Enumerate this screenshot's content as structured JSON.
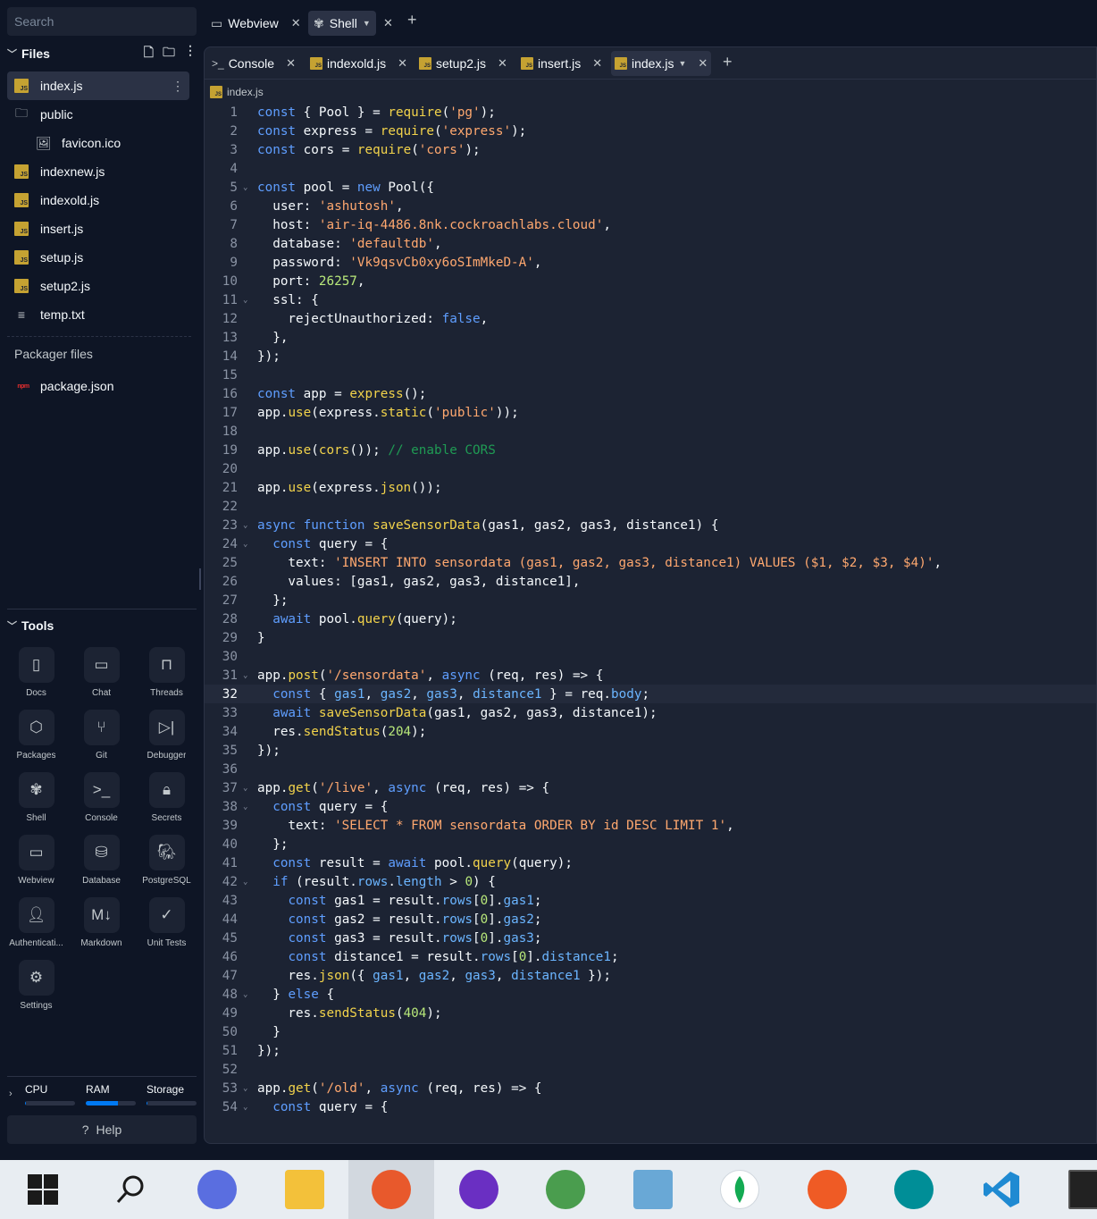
{
  "sidebar": {
    "search_placeholder": "Search",
    "files_title": "Files",
    "tree": [
      {
        "label": "index.js",
        "type": "js",
        "active": true
      },
      {
        "label": "public",
        "type": "folder"
      },
      {
        "label": "favicon.ico",
        "type": "image",
        "child": true
      },
      {
        "label": "indexnew.js",
        "type": "js"
      },
      {
        "label": "indexold.js",
        "type": "js"
      },
      {
        "label": "insert.js",
        "type": "js"
      },
      {
        "label": "setup.js",
        "type": "js"
      },
      {
        "label": "setup2.js",
        "type": "js"
      },
      {
        "label": "temp.txt",
        "type": "text"
      }
    ],
    "packager_title": "Packager files",
    "packager_item": "package.json",
    "tools_title": "Tools",
    "tools": [
      {
        "label": "Docs",
        "icon": "book-icon",
        "glyph": "▯"
      },
      {
        "label": "Chat",
        "icon": "chat-icon",
        "glyph": "▭"
      },
      {
        "label": "Threads",
        "icon": "inbox-icon",
        "glyph": "⊓"
      },
      {
        "label": "Packages",
        "icon": "package-icon",
        "glyph": "⬡"
      },
      {
        "label": "Git",
        "icon": "git-icon",
        "glyph": "⑂"
      },
      {
        "label": "Debugger",
        "icon": "debugger-icon",
        "glyph": "▷|"
      },
      {
        "label": "Shell",
        "icon": "shell-icon",
        "glyph": "✾"
      },
      {
        "label": "Console",
        "icon": "console-icon",
        "glyph": ">_"
      },
      {
        "label": "Secrets",
        "icon": "lock-icon",
        "glyph": "🔒︎"
      },
      {
        "label": "Webview",
        "icon": "monitor-icon",
        "glyph": "▭"
      },
      {
        "label": "Database",
        "icon": "database-icon",
        "glyph": "⛁"
      },
      {
        "label": "PostgreSQL",
        "icon": "postgresql-icon",
        "glyph": "🐘︎"
      },
      {
        "label": "Authenticati...",
        "icon": "user-icon",
        "glyph": "👤︎"
      },
      {
        "label": "Markdown",
        "icon": "markdown-icon",
        "glyph": "M↓"
      },
      {
        "label": "Unit Tests",
        "icon": "check-icon",
        "glyph": "✓"
      },
      {
        "label": "Settings",
        "icon": "gear-icon",
        "glyph": "⚙"
      }
    ],
    "resources": [
      {
        "label": "CPU",
        "fill": 0.02
      },
      {
        "label": "RAM",
        "fill": 0.65
      },
      {
        "label": "Storage",
        "fill": 0.02
      }
    ],
    "help": "Help"
  },
  "top_tabs": [
    {
      "label": "Webview",
      "icon": "monitor-icon"
    },
    {
      "label": "Shell",
      "icon": "shell-icon",
      "active": true
    }
  ],
  "editor_tabs": [
    {
      "label": "Console",
      "type": "console"
    },
    {
      "label": "indexold.js",
      "type": "js"
    },
    {
      "label": "setup2.js",
      "type": "js"
    },
    {
      "label": "insert.js",
      "type": "js"
    },
    {
      "label": "index.js",
      "type": "js",
      "active": true
    }
  ],
  "breadcrumb": "index.js",
  "current_line": 32,
  "code": [
    [
      [
        "kw",
        "const"
      ],
      [
        "p",
        " { Pool } = "
      ],
      [
        "fn",
        "require"
      ],
      [
        "p",
        "("
      ],
      [
        "str",
        "'pg'"
      ],
      [
        "p",
        ");"
      ]
    ],
    [
      [
        "kw",
        "const"
      ],
      [
        "p",
        " express = "
      ],
      [
        "fn",
        "require"
      ],
      [
        "p",
        "("
      ],
      [
        "str",
        "'express'"
      ],
      [
        "p",
        ");"
      ]
    ],
    [
      [
        "kw",
        "const"
      ],
      [
        "p",
        " cors = "
      ],
      [
        "fn",
        "require"
      ],
      [
        "p",
        "("
      ],
      [
        "str",
        "'cors'"
      ],
      [
        "p",
        ");"
      ]
    ],
    [],
    [
      [
        "kw",
        "const"
      ],
      [
        "p",
        " pool = "
      ],
      [
        "kw",
        "new"
      ],
      [
        "p",
        " Pool({"
      ]
    ],
    [
      [
        "p",
        "  user: "
      ],
      [
        "str",
        "'ashutosh'"
      ],
      [
        "p",
        ","
      ]
    ],
    [
      [
        "p",
        "  host: "
      ],
      [
        "str",
        "'air-iq-4486.8nk.cockroachlabs.cloud'"
      ],
      [
        "p",
        ","
      ]
    ],
    [
      [
        "p",
        "  database: "
      ],
      [
        "str",
        "'defaultdb'"
      ],
      [
        "p",
        ","
      ]
    ],
    [
      [
        "p",
        "  password: "
      ],
      [
        "str",
        "'Vk9qsvCb0xy6oSImMkeD-A'"
      ],
      [
        "p",
        ","
      ]
    ],
    [
      [
        "p",
        "  port: "
      ],
      [
        "num",
        "26257"
      ],
      [
        "p",
        ","
      ]
    ],
    [
      [
        "p",
        "  ssl: {"
      ]
    ],
    [
      [
        "p",
        "    rejectUnauthorized: "
      ],
      [
        "kw",
        "false"
      ],
      [
        "p",
        ","
      ]
    ],
    [
      [
        "p",
        "  },"
      ]
    ],
    [
      [
        "p",
        "});"
      ]
    ],
    [],
    [
      [
        "kw",
        "const"
      ],
      [
        "p",
        " app = "
      ],
      [
        "fn",
        "express"
      ],
      [
        "p",
        "();"
      ]
    ],
    [
      [
        "p",
        "app."
      ],
      [
        "fn",
        "use"
      ],
      [
        "p",
        "(express."
      ],
      [
        "fn",
        "static"
      ],
      [
        "p",
        "("
      ],
      [
        "str",
        "'public'"
      ],
      [
        "p",
        "));"
      ]
    ],
    [],
    [
      [
        "p",
        "app."
      ],
      [
        "fn",
        "use"
      ],
      [
        "p",
        "("
      ],
      [
        "fn",
        "cors"
      ],
      [
        "p",
        "()); "
      ],
      [
        "cm",
        "// enable CORS"
      ]
    ],
    [],
    [
      [
        "p",
        "app."
      ],
      [
        "fn",
        "use"
      ],
      [
        "p",
        "(express."
      ],
      [
        "fn",
        "json"
      ],
      [
        "p",
        "());"
      ]
    ],
    [],
    [
      [
        "kw",
        "async function"
      ],
      [
        "p",
        " "
      ],
      [
        "fn",
        "saveSensorData"
      ],
      [
        "p",
        "(gas1, gas2, gas3, distance1) {"
      ]
    ],
    [
      [
        "p",
        "  "
      ],
      [
        "kw",
        "const"
      ],
      [
        "p",
        " query = {"
      ]
    ],
    [
      [
        "p",
        "    text: "
      ],
      [
        "str",
        "'INSERT INTO sensordata (gas1, gas2, gas3, distance1) VALUES ($1, $2, $3, $4)'"
      ],
      [
        "p",
        ","
      ]
    ],
    [
      [
        "p",
        "    values: [gas1, gas2, gas3, distance1],"
      ]
    ],
    [
      [
        "p",
        "  };"
      ]
    ],
    [
      [
        "p",
        "  "
      ],
      [
        "kw",
        "await"
      ],
      [
        "p",
        " pool."
      ],
      [
        "fn",
        "query"
      ],
      [
        "p",
        "(query);"
      ]
    ],
    [
      [
        "p",
        "}"
      ]
    ],
    [],
    [
      [
        "p",
        "app."
      ],
      [
        "fn",
        "post"
      ],
      [
        "p",
        "("
      ],
      [
        "str",
        "'/sensordata'"
      ],
      [
        "p",
        ", "
      ],
      [
        "kw",
        "async"
      ],
      [
        "p",
        " (req, res) => {"
      ]
    ],
    [
      [
        "p",
        "  "
      ],
      [
        "kw",
        "const"
      ],
      [
        "p",
        " { "
      ],
      [
        "prop",
        "gas1"
      ],
      [
        "p",
        ", "
      ],
      [
        "prop",
        "gas2"
      ],
      [
        "p",
        ", "
      ],
      [
        "prop",
        "gas3"
      ],
      [
        "p",
        ", "
      ],
      [
        "prop",
        "distance1"
      ],
      [
        "p",
        " } = req."
      ],
      [
        "prop",
        "body"
      ],
      [
        "p",
        ";"
      ]
    ],
    [
      [
        "p",
        "  "
      ],
      [
        "kw",
        "await"
      ],
      [
        "p",
        " "
      ],
      [
        "fn",
        "saveSensorData"
      ],
      [
        "p",
        "(gas1, gas2, gas3, distance1);"
      ]
    ],
    [
      [
        "p",
        "  res."
      ],
      [
        "fn",
        "sendStatus"
      ],
      [
        "p",
        "("
      ],
      [
        "num",
        "204"
      ],
      [
        "p",
        ");"
      ]
    ],
    [
      [
        "p",
        "});"
      ]
    ],
    [],
    [
      [
        "p",
        "app."
      ],
      [
        "fn",
        "get"
      ],
      [
        "p",
        "("
      ],
      [
        "str",
        "'/live'"
      ],
      [
        "p",
        ", "
      ],
      [
        "kw",
        "async"
      ],
      [
        "p",
        " (req, res) => {"
      ]
    ],
    [
      [
        "p",
        "  "
      ],
      [
        "kw",
        "const"
      ],
      [
        "p",
        " query = {"
      ]
    ],
    [
      [
        "p",
        "    text: "
      ],
      [
        "str",
        "'SELECT * FROM sensordata ORDER BY id DESC LIMIT 1'"
      ],
      [
        "p",
        ","
      ]
    ],
    [
      [
        "p",
        "  };"
      ]
    ],
    [
      [
        "p",
        "  "
      ],
      [
        "kw",
        "const"
      ],
      [
        "p",
        " result = "
      ],
      [
        "kw",
        "await"
      ],
      [
        "p",
        " pool."
      ],
      [
        "fn",
        "query"
      ],
      [
        "p",
        "(query);"
      ]
    ],
    [
      [
        "p",
        "  "
      ],
      [
        "kw",
        "if"
      ],
      [
        "p",
        " (result."
      ],
      [
        "prop",
        "rows"
      ],
      [
        "p",
        "."
      ],
      [
        "prop",
        "length"
      ],
      [
        "p",
        " > "
      ],
      [
        "num",
        "0"
      ],
      [
        "p",
        ") {"
      ]
    ],
    [
      [
        "p",
        "    "
      ],
      [
        "kw",
        "const"
      ],
      [
        "p",
        " gas1 = result."
      ],
      [
        "prop",
        "rows"
      ],
      [
        "p",
        "["
      ],
      [
        "num",
        "0"
      ],
      [
        "p",
        "]."
      ],
      [
        "prop",
        "gas1"
      ],
      [
        "p",
        ";"
      ]
    ],
    [
      [
        "p",
        "    "
      ],
      [
        "kw",
        "const"
      ],
      [
        "p",
        " gas2 = result."
      ],
      [
        "prop",
        "rows"
      ],
      [
        "p",
        "["
      ],
      [
        "num",
        "0"
      ],
      [
        "p",
        "]."
      ],
      [
        "prop",
        "gas2"
      ],
      [
        "p",
        ";"
      ]
    ],
    [
      [
        "p",
        "    "
      ],
      [
        "kw",
        "const"
      ],
      [
        "p",
        " gas3 = result."
      ],
      [
        "prop",
        "rows"
      ],
      [
        "p",
        "["
      ],
      [
        "num",
        "0"
      ],
      [
        "p",
        "]."
      ],
      [
        "prop",
        "gas3"
      ],
      [
        "p",
        ";"
      ]
    ],
    [
      [
        "p",
        "    "
      ],
      [
        "kw",
        "const"
      ],
      [
        "p",
        " distance1 = result."
      ],
      [
        "prop",
        "rows"
      ],
      [
        "p",
        "["
      ],
      [
        "num",
        "0"
      ],
      [
        "p",
        "]."
      ],
      [
        "prop",
        "distance1"
      ],
      [
        "p",
        ";"
      ]
    ],
    [
      [
        "p",
        "    res."
      ],
      [
        "fn",
        "json"
      ],
      [
        "p",
        "({ "
      ],
      [
        "prop",
        "gas1"
      ],
      [
        "p",
        ", "
      ],
      [
        "prop",
        "gas2"
      ],
      [
        "p",
        ", "
      ],
      [
        "prop",
        "gas3"
      ],
      [
        "p",
        ", "
      ],
      [
        "prop",
        "distance1"
      ],
      [
        "p",
        " });"
      ]
    ],
    [
      [
        "p",
        "  } "
      ],
      [
        "kw",
        "else"
      ],
      [
        "p",
        " {"
      ]
    ],
    [
      [
        "p",
        "    res."
      ],
      [
        "fn",
        "sendStatus"
      ],
      [
        "p",
        "("
      ],
      [
        "num",
        "404"
      ],
      [
        "p",
        ");"
      ]
    ],
    [
      [
        "p",
        "  }"
      ]
    ],
    [
      [
        "p",
        "});"
      ]
    ],
    [],
    [
      [
        "p",
        "app."
      ],
      [
        "fn",
        "get"
      ],
      [
        "p",
        "("
      ],
      [
        "str",
        "'/old'"
      ],
      [
        "p",
        ", "
      ],
      [
        "kw",
        "async"
      ],
      [
        "p",
        " (req, res) => {"
      ]
    ],
    [
      [
        "p",
        "  "
      ],
      [
        "kw",
        "const"
      ],
      [
        "p",
        " query = {"
      ]
    ]
  ],
  "fold_lines": [
    5,
    11,
    23,
    24,
    31,
    37,
    38,
    42,
    48,
    53,
    54
  ],
  "taskbar": [
    {
      "name": "windows-start",
      "icon": "windows-icon",
      "color": "#1a1a1a"
    },
    {
      "name": "search",
      "icon": "search-icon",
      "color": "#1a1a1a"
    },
    {
      "name": "copilot",
      "icon": "copilot-icon",
      "color": "#5a6ee0"
    },
    {
      "name": "file-explorer",
      "icon": "folder-icon",
      "color": "#f3c13a"
    },
    {
      "name": "firefox",
      "icon": "firefox-icon",
      "color": "#e8592c",
      "active": true
    },
    {
      "name": "firefox-private",
      "icon": "mask-icon",
      "color": "#6a2fc2"
    },
    {
      "name": "chrome",
      "icon": "chrome-icon",
      "color": "#4a9d4e"
    },
    {
      "name": "notepad",
      "icon": "notepad-icon",
      "color": "#69a8d6"
    },
    {
      "name": "mongodb-compass",
      "icon": "leaf-icon",
      "color": "#ffffff"
    },
    {
      "name": "postman",
      "icon": "postman-icon",
      "color": "#ef5b25"
    },
    {
      "name": "arduino",
      "icon": "arduino-icon",
      "color": "#008e97"
    },
    {
      "name": "vscode",
      "icon": "vscode-icon",
      "color": "#1f8ad2"
    },
    {
      "name": "terminal",
      "icon": "terminal-icon",
      "color": "#222222"
    }
  ]
}
